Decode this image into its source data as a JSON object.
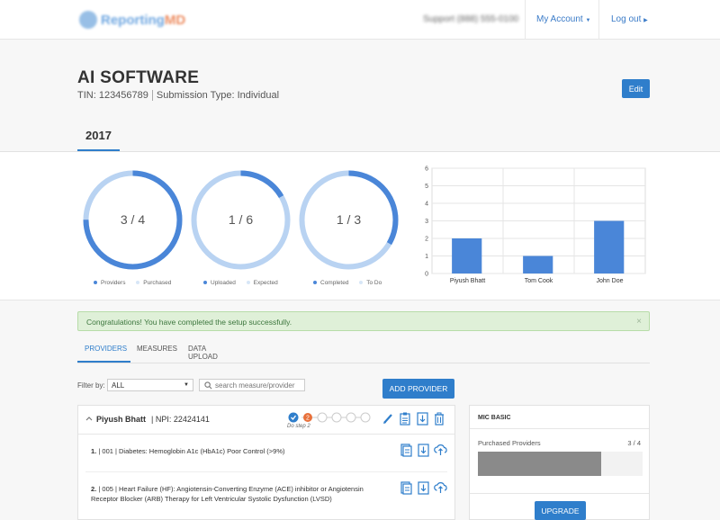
{
  "header": {
    "logo_text_main": "Reporting",
    "logo_text_accent": "MD",
    "support_text": "Support (888) 555-0100",
    "my_account_label": "My Account",
    "logout_label": "Log out"
  },
  "practice": {
    "name": "AI SOFTWARE",
    "tin": "TIN: 123456789",
    "submission_type": "Submission Type: Individual",
    "edit_label": "Edit"
  },
  "year_tab": "2017",
  "donuts": [
    {
      "label": "3 / 4",
      "done": 3,
      "total": 4,
      "legend": [
        "Providers",
        "Purchased"
      ]
    },
    {
      "label": "1 / 6",
      "done": 1,
      "total": 6,
      "legend": [
        "Uploaded",
        "Expected"
      ]
    },
    {
      "label": "1 / 3",
      "done": 1,
      "total": 3,
      "legend": [
        "Completed",
        "To Do"
      ]
    }
  ],
  "chart_data": {
    "type": "bar",
    "categories": [
      "Piyush Bhatt",
      "Tom Cook",
      "John Doe"
    ],
    "values": [
      2,
      1,
      3
    ],
    "ylim": [
      0,
      6
    ],
    "yticks": [
      0,
      1,
      2,
      3,
      4,
      5,
      6
    ],
    "grid": true,
    "color": "#4a86d8"
  },
  "alert": {
    "message": "Congratulations! You have completed the setup successfully.",
    "close": "×"
  },
  "tabs": [
    "PROVIDERS",
    "MEASURES",
    "DATA UPLOAD"
  ],
  "filter": {
    "label": "Filter by:",
    "selected": "ALL",
    "search_placeholder": "search measure/provider",
    "add_provider_label": "ADD PROVIDER"
  },
  "provider": {
    "name": "Piyush Bhatt",
    "npi": "| NPI: 22424141",
    "step_badge": "2",
    "step_caption": "Do step 2",
    "measures": [
      {
        "num": "1.",
        "text": "| 001 | Diabetes: Hemoglobin A1c (HbA1c) Poor Control (>9%)"
      },
      {
        "num": "2.",
        "text": "| 005 | Heart Failure (HF): Angiotensin-Converting Enzyme (ACE) inhibitor or Angiotensin Receptor Blocker (ARB) Therapy for Left Ventricular Systolic Dysfunction (LVSD)"
      }
    ]
  },
  "mic": {
    "title": "MIC BASIC",
    "purchased_label": "Purchased Providers",
    "purchased_count": "3 / 4",
    "progress_fraction": 0.75,
    "upgrade_label": "UPGRADE"
  },
  "colors": {
    "accent": "#2f7ecb",
    "donut_fill": "#4a86d8",
    "donut_track": "#b9d3f2",
    "alert_bg": "#dff0d8",
    "step_badge": "#e8703a"
  }
}
